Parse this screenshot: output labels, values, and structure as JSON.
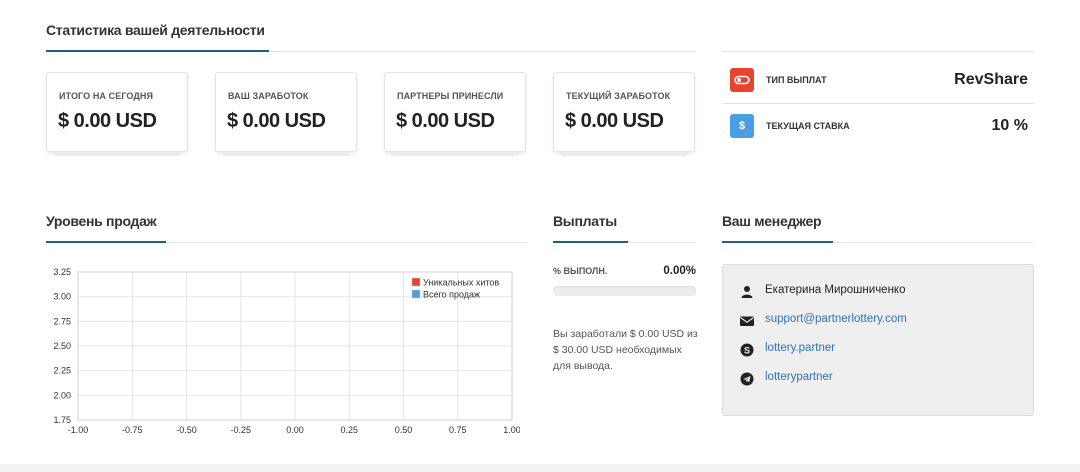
{
  "stats": {
    "title": "Статистика вашей деятельности",
    "cards": [
      {
        "label": "ИТОГО НА СЕГОДНЯ",
        "value": "$ 0.00 USD"
      },
      {
        "label": "ВАШ ЗАРАБОТОК",
        "value": "$ 0.00 USD"
      },
      {
        "label": "ПАРТНЕРЫ ПРИНЕСЛИ",
        "value": "$ 0.00 USD"
      },
      {
        "label": "ТЕКУЩИЙ ЗАРАБОТОК",
        "value": "$ 0.00 USD"
      }
    ]
  },
  "payout": {
    "type_label": "ТИП ВЫПЛАТ",
    "type_value": "RevShare",
    "type_icon": "toggle-icon",
    "rate_label": "ТЕКУЩАЯ СТАВКА",
    "rate_value": "10 %",
    "rate_icon": "dollar-icon",
    "rate_icon_glyph": "$",
    "colors": {
      "type_badge": "#e8432e",
      "rate_badge": "#4a9ee5"
    }
  },
  "sales": {
    "title": "Уровень продаж"
  },
  "chart_data": {
    "type": "line",
    "title": "",
    "xlabel": "",
    "ylabel": "",
    "x": [],
    "series": [
      {
        "name": "Уникальных хитов",
        "values": [],
        "color": "#e8432e"
      },
      {
        "name": "Всего продаж",
        "values": [],
        "color": "#4a9ee5"
      }
    ],
    "xlim": [
      -1.0,
      1.0
    ],
    "ylim": [
      1.75,
      3.25
    ],
    "x_ticks": [
      "-1.00",
      "-0.75",
      "-0.50",
      "-0.25",
      "0.00",
      "0.25",
      "0.50",
      "0.75",
      "1.00"
    ],
    "y_ticks": [
      "3.25",
      "3.00",
      "2.75",
      "2.50",
      "2.25",
      "2.00",
      "1.75"
    ],
    "grid": true,
    "legend_position": "top-right"
  },
  "payments": {
    "title": "Выплаты",
    "progress_label": "% ВЫПОЛН.",
    "progress_value": "0.00%",
    "progress_fraction": 0.0,
    "note": "Вы заработали $ 0.00 USD из $ 30.00 USD необходимых для вывода."
  },
  "manager": {
    "title": "Ваш менеджер",
    "name": "Екатерина Мирошниченко",
    "email": "support@partnerlottery.com",
    "skype": "lottery.partner",
    "telegram": "lotterypartner"
  }
}
